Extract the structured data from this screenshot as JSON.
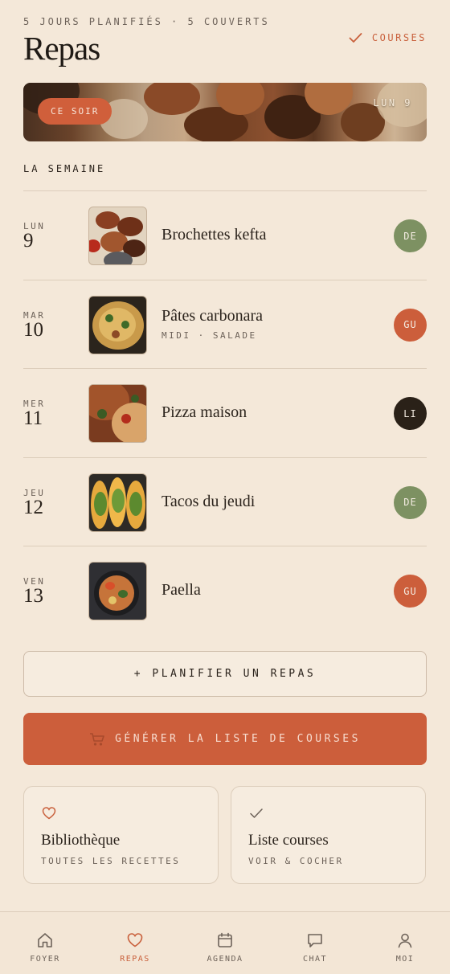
{
  "header": {
    "subtitle": "5 JOURS PLANIFIÉS · 5 COUVERTS",
    "title": "Repas",
    "courses_link": "COURSES"
  },
  "hero": {
    "badge": "CE SOIR",
    "date": "LUN 9"
  },
  "week": {
    "label": "LA SEMAINE",
    "meals": [
      {
        "day": "LUN",
        "num": "9",
        "name": "Brochettes kefta",
        "note": "",
        "avatar": "DE",
        "avatar_color": "#7d9162"
      },
      {
        "day": "MAR",
        "num": "10",
        "name": "Pâtes carbonara",
        "note": "MIDI · SALADE",
        "avatar": "GU",
        "avatar_color": "#cc5e3b"
      },
      {
        "day": "MER",
        "num": "11",
        "name": "Pizza maison",
        "note": "",
        "avatar": "LI",
        "avatar_color": "#2a2118"
      },
      {
        "day": "JEU",
        "num": "12",
        "name": "Tacos du jeudi",
        "note": "",
        "avatar": "DE",
        "avatar_color": "#7d9162"
      },
      {
        "day": "VEN",
        "num": "13",
        "name": "Paella",
        "note": "",
        "avatar": "GU",
        "avatar_color": "#cc5e3b"
      }
    ]
  },
  "actions": {
    "plan": "+ PLANIFIER UN REPAS",
    "generate": "GÉNÉRER LA LISTE DE COURSES"
  },
  "cards": {
    "library": {
      "title": "Bibliothèque",
      "subtitle": "TOUTES LES RECETTES",
      "icon": "heart-icon"
    },
    "shopping": {
      "title": "Liste courses",
      "subtitle": "VOIR & COCHER",
      "icon": "check-icon"
    }
  },
  "nav": {
    "items": [
      {
        "label": "FOYER",
        "icon": "home-icon"
      },
      {
        "label": "REPAS",
        "icon": "heart-icon"
      },
      {
        "label": "AGENDA",
        "icon": "calendar-icon"
      },
      {
        "label": "CHAT",
        "icon": "chat-icon"
      },
      {
        "label": "MOI",
        "icon": "person-icon"
      }
    ],
    "active": "REPAS"
  },
  "colors": {
    "background": "#f4e8d9",
    "accent": "#cc5e3b",
    "text": "#2b231c",
    "muted": "#6d6259"
  }
}
